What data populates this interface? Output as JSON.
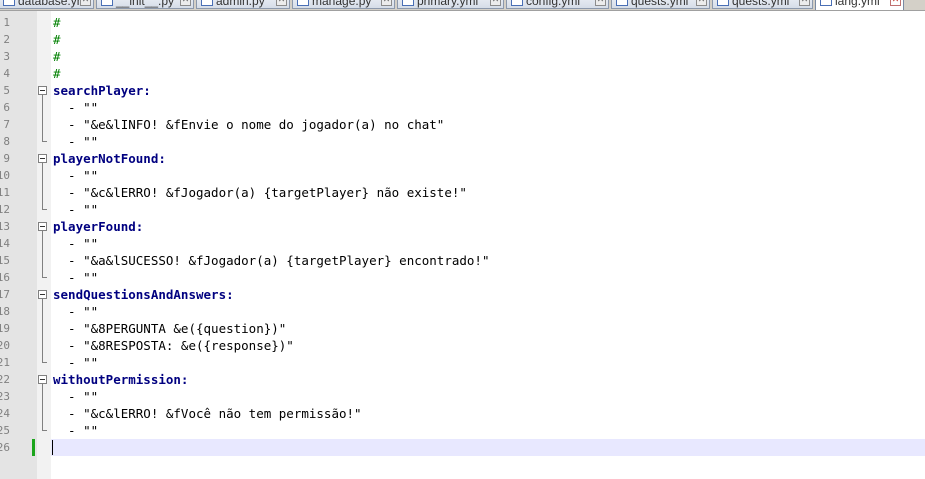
{
  "tabs": [
    {
      "label": "database.yml",
      "active": false
    },
    {
      "label": "__init__.py",
      "active": false
    },
    {
      "label": "admin.py",
      "active": false
    },
    {
      "label": "manage.py",
      "active": false
    },
    {
      "label": "primary.yml",
      "active": false
    },
    {
      "label": "config.yml",
      "active": false
    },
    {
      "label": "quests.yml",
      "active": false
    },
    {
      "label": "quests.yml",
      "active": false
    },
    {
      "label": "lang.yml",
      "active": true
    }
  ],
  "line_numbers": [
    "1",
    "2",
    "3",
    "4",
    "5",
    "6",
    "7",
    "8",
    "9",
    "10",
    "11",
    "12",
    "13",
    "14",
    "15",
    "16",
    "17",
    "18",
    "19",
    "20",
    "21",
    "22",
    "23",
    "24",
    "25",
    "26"
  ],
  "lines": [
    {
      "kind": "comment",
      "text": "#"
    },
    {
      "kind": "comment",
      "text": "#"
    },
    {
      "kind": "comment",
      "text": "#"
    },
    {
      "kind": "comment",
      "text": "#"
    },
    {
      "kind": "key",
      "text": "searchPlayer:"
    },
    {
      "kind": "item",
      "text": "  - \"\""
    },
    {
      "kind": "item",
      "text": "  - \"&e&lINFO! &fEnvie o nome do jogador(a) no chat\""
    },
    {
      "kind": "item",
      "text": "  - \"\""
    },
    {
      "kind": "key",
      "text": "playerNotFound:"
    },
    {
      "kind": "item",
      "text": "  - \"\""
    },
    {
      "kind": "item",
      "text": "  - \"&c&lERRO! &fJogador(a) {targetPlayer} não existe!\""
    },
    {
      "kind": "item",
      "text": "  - \"\""
    },
    {
      "kind": "key",
      "text": "playerFound:"
    },
    {
      "kind": "item",
      "text": "  - \"\""
    },
    {
      "kind": "item",
      "text": "  - \"&a&lSUCESSO! &fJogador(a) {targetPlayer} encontrado!\""
    },
    {
      "kind": "item",
      "text": "  - \"\""
    },
    {
      "kind": "key",
      "text": "sendQuestionsAndAnswers:"
    },
    {
      "kind": "item",
      "text": "  - \"\""
    },
    {
      "kind": "item",
      "text": "  - \"&8PERGUNTA &e({question})\""
    },
    {
      "kind": "item",
      "text": "  - \"&8RESPOSTA: &e({response})\""
    },
    {
      "kind": "item",
      "text": "  - \"\""
    },
    {
      "kind": "key",
      "text": "withoutPermission:"
    },
    {
      "kind": "item",
      "text": "  - \"\""
    },
    {
      "kind": "item",
      "text": "  - \"&c&lERRO! &fVocê não tem permissão!\""
    },
    {
      "kind": "item",
      "text": "  - \"\""
    },
    {
      "kind": "empty",
      "text": ""
    }
  ],
  "colors": {
    "key": "#000080",
    "comment": "#008000",
    "current_line": "#e8e8ff",
    "change_marker": "#1ca51c"
  },
  "icons": {
    "tab_file": "file-icon",
    "tab_close": "close-icon",
    "fold": "fold-minus-icon"
  }
}
